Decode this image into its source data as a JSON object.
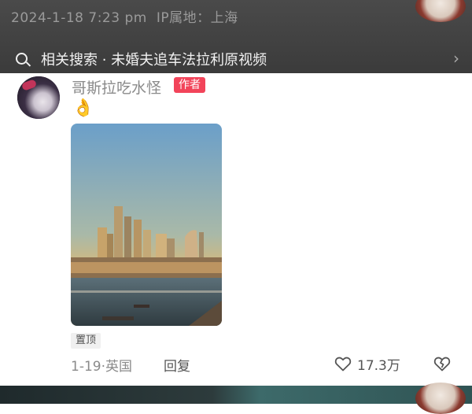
{
  "header": {
    "timestamp": "2024-1-18 7:23 pm",
    "ip_location": "IP属地：上海"
  },
  "search_bar": {
    "icon": "search-icon",
    "text": "相关搜索 · 未婚夫追车法拉利原视频",
    "chevron": "chevron-right-icon"
  },
  "comment": {
    "username": "哥斯拉吃水怪",
    "author_badge": "作者",
    "text": "👌",
    "pinned_label": "置顶",
    "date_location": "1-19·英国",
    "reply_label": "回复",
    "like_count": "17.3万",
    "like_icon": "heart-outline-icon",
    "dislike_icon": "broken-heart-icon"
  },
  "colors": {
    "author_badge": "#f2445a",
    "top_band": "#3f3f3f",
    "muted_text": "#8a8a8a"
  }
}
